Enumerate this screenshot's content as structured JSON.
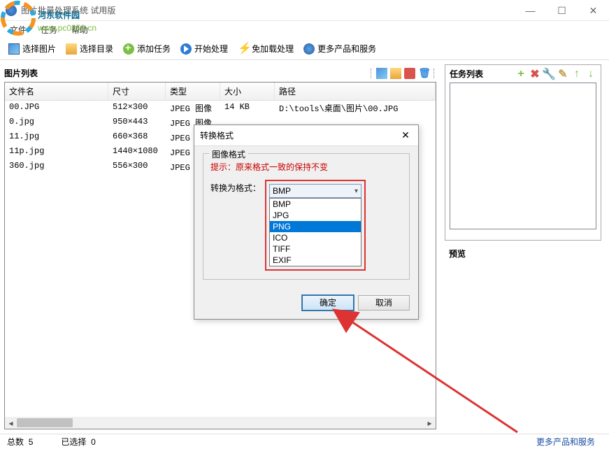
{
  "app_title": "图片批量处理系统 试用版",
  "watermark": {
    "brand": "河东软件园",
    "url": "www.pc0359.cn"
  },
  "menu": {
    "file": "文件",
    "task": "任务",
    "help": "帮助"
  },
  "toolbar": {
    "select_image": "选择图片",
    "select_dir": "选择目录",
    "add_task": "添加任务",
    "start": "开始处理",
    "free": "免加载处理",
    "more": "更多产品和服务"
  },
  "left": {
    "title": "图片列表",
    "cols": {
      "name": "文件名",
      "dim": "尺寸",
      "type": "类型",
      "size": "大小",
      "path": "路径"
    },
    "rows": [
      {
        "name": "00.JPG",
        "dim": "512×300",
        "type": "JPEG 图像",
        "size": "14 KB",
        "path": "D:\\tools\\桌面\\图片\\00.JPG"
      },
      {
        "name": "0.jpg",
        "dim": "950×443",
        "type": "JPEG 图像",
        "size": "",
        "path": ""
      },
      {
        "name": "11.jpg",
        "dim": "660×368",
        "type": "JPEG 图像",
        "size": "",
        "path": ""
      },
      {
        "name": "11p.jpg",
        "dim": "1440×1080",
        "type": "JPEG 图像",
        "size": "",
        "path": ""
      },
      {
        "name": "360.jpg",
        "dim": "556×300",
        "type": "JPEG 图像",
        "size": "",
        "path": ""
      }
    ]
  },
  "right": {
    "task_title": "任务列表",
    "preview_title": "预览"
  },
  "dialog": {
    "title": "转换格式",
    "group": "图像格式",
    "hint": "提示：原来格式一致的保持不变",
    "label": "转换为格式：",
    "selected": "BMP",
    "options": [
      "BMP",
      "JPG",
      "PNG",
      "ICO",
      "TIFF",
      "EXIF"
    ],
    "ok": "确定",
    "cancel": "取消"
  },
  "status": {
    "total_label": "总数",
    "total": "5",
    "sel_label": "已选择",
    "sel": "0",
    "link": "更多产品和服务"
  }
}
